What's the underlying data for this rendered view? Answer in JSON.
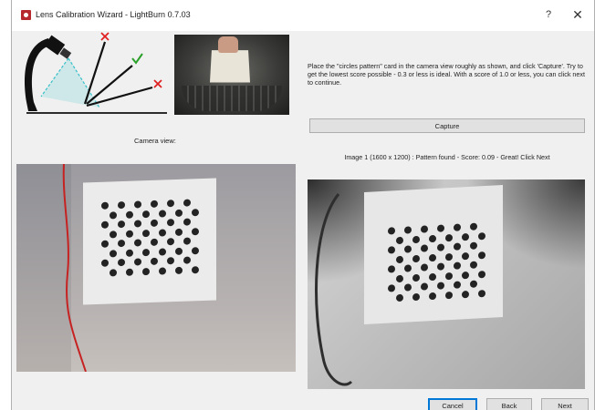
{
  "window": {
    "title": "Lens Calibration Wizard - LightBurn 0.7.03",
    "help_label": "?",
    "close_label": "✕"
  },
  "instructions": "Place the \"circles pattern\" card in the camera view roughly as shown, and click 'Capture'. Try to get the lowest score possible - 0.3 or less is ideal. With a score of 1.0 or less, you can click next to continue.",
  "capture_label": "Capture",
  "status": "Image 1 (1600 x 1200) : Pattern found - Score: 0.09 - Great! Click Next",
  "camera_view_label": "Camera view:",
  "buttons": {
    "cancel": "Cancel",
    "back": "Back",
    "next": "Next"
  },
  "colors": {
    "accent": "#0078d7",
    "diagram_bad": "#e02020",
    "diagram_good": "#2aa02a",
    "diagram_beam": "#35c0c8"
  },
  "icons": [
    "app-icon",
    "help-icon",
    "close-icon"
  ]
}
